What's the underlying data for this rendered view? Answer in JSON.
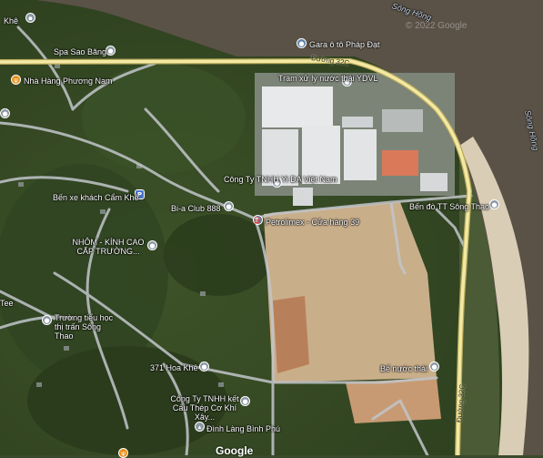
{
  "map": {
    "river_labels": [
      "Sông Hồng",
      "Sông Hồng"
    ],
    "watermark": "© 2022 Google",
    "google_logo": "Google",
    "roads": {
      "road_32c_a": "Đường 32C",
      "road_32c_b": "Đường 32C"
    },
    "places": [
      {
        "name": "Gara ô tô Pháp Đạt",
        "icon": "pin-icon"
      },
      {
        "name": "Spa Sao Băng",
        "icon": "pin-icon"
      },
      {
        "name": "Nhà Hàng Phương Nam",
        "icon": "restaurant-icon"
      },
      {
        "name": "Trạm xử lý nước thải YDVL",
        "icon": "pin-icon"
      },
      {
        "name": "Công Ty TNHH Yi DA Việt Nam",
        "icon": "pin-icon"
      },
      {
        "name": "Bến xe khách Cẩm Khê",
        "icon": "parking-icon"
      },
      {
        "name": "Bi-a Club 888",
        "icon": "pin-icon"
      },
      {
        "name": "Petrolimex - Cửa hàng 39",
        "icon": "gas-station-icon"
      },
      {
        "name": "Bến đò TT Sông Thao",
        "icon": "pin-icon"
      },
      {
        "name": "NHÔM - KÍNH CAO CẤP TRƯỜNG...",
        "icon": "pin-icon"
      },
      {
        "name": "Trường tiểu học thị trấn Sông Thao",
        "icon": "school-icon"
      },
      {
        "name": "371 Hoa Khê",
        "icon": "pin-icon"
      },
      {
        "name": "Bể nước thải",
        "icon": "pin-icon"
      },
      {
        "name": "Công Ty TNHH kết Cấu Thép Cơ Khí Xây...",
        "icon": "pin-icon"
      },
      {
        "name": "Đình Làng Bình Phú",
        "icon": "temple-icon"
      },
      {
        "name": "Khê",
        "icon": "pin-icon"
      },
      {
        "name": "Tee",
        "icon": "pin-icon"
      }
    ]
  }
}
